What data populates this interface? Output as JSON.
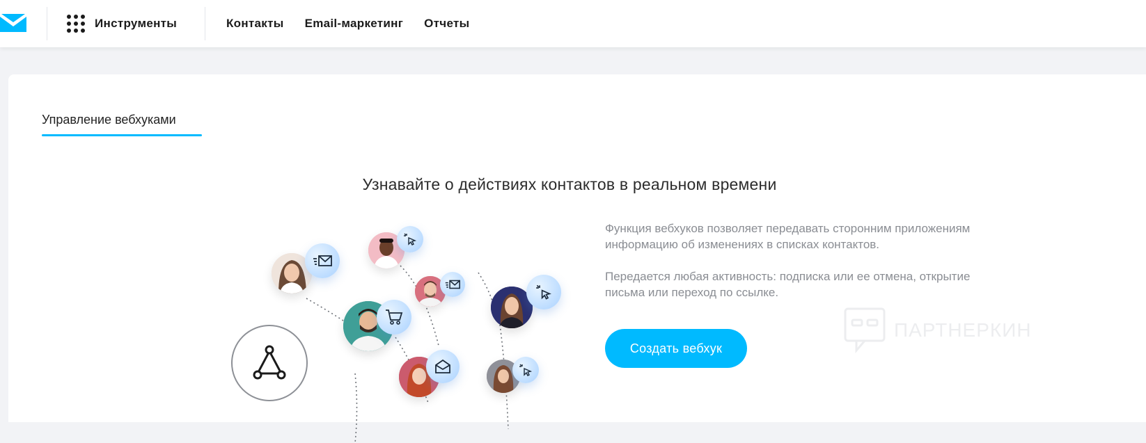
{
  "header": {
    "tools_label": "Инструменты",
    "nav": [
      "Контакты",
      "Email-маркетинг",
      "Отчеты"
    ]
  },
  "main": {
    "tab_label": "Управление вебхуками",
    "headline": "Узнавайте о действиях контактов в реальном времени",
    "description": [
      "Функция вебхуков позволяет передавать сторонним приложениям информацию об изменениях в списках контактов.",
      "Передается любая активность: подписка или ее отмена, открытие письма или переход по ссылке."
    ],
    "cta_label": "Создать вебхук"
  },
  "illustration": {
    "badges": [
      "envelope-send-icon",
      "click-icon",
      "envelope-send-icon",
      "cart-icon",
      "click-icon",
      "envelope-open-icon",
      "click-icon"
    ],
    "hub_icon": "webhook-icon"
  },
  "watermark": {
    "text": "ПАРТНЕРКИН"
  },
  "colors": {
    "accent": "#00baff",
    "text_primary": "#1b1b1b",
    "text_muted": "#8a8d93",
    "page_background": "#f2f3f6"
  }
}
